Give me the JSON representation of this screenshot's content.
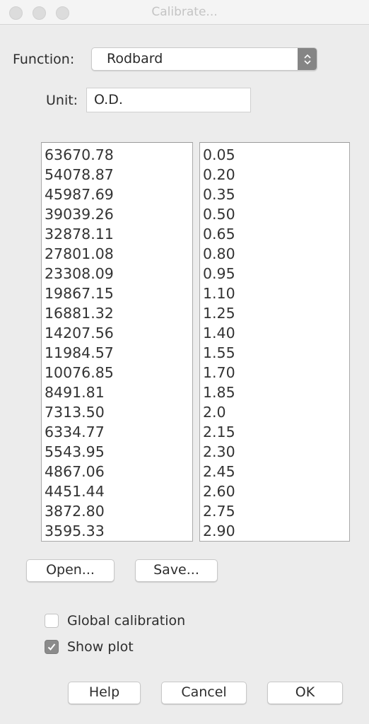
{
  "window": {
    "title": "Calibrate..."
  },
  "form": {
    "function_label": "Function:",
    "function_value": "Rodbard",
    "unit_label": "Unit:",
    "unit_value": "O.D."
  },
  "measured_values": [
    "63670.78",
    "54078.87",
    "45987.69",
    "39039.26",
    "32878.11",
    "27801.08",
    "23308.09",
    "19867.15",
    "16881.32",
    "14207.56",
    "11984.57",
    "10076.85",
    "8491.81",
    "7313.50",
    "6334.77",
    "5543.95",
    "4867.06",
    "4451.44",
    "3872.80",
    "3595.33"
  ],
  "calibrated_values": [
    "0.05",
    "0.20",
    "0.35",
    "0.50",
    "0.65",
    "0.80",
    "0.95",
    "1.10",
    "1.25",
    "1.40",
    "1.55",
    "1.70",
    "1.85",
    "2.0",
    "2.15",
    "2.30",
    "2.45",
    "2.60",
    "2.75",
    "2.90"
  ],
  "file_buttons": {
    "open": "Open...",
    "save": "Save..."
  },
  "options": {
    "global_calibration": {
      "label": "Global calibration",
      "checked": false
    },
    "show_plot": {
      "label": "Show plot",
      "checked": true
    }
  },
  "dialog_buttons": {
    "help": "Help",
    "cancel": "Cancel",
    "ok": "OK"
  },
  "icons": {
    "select_arrows": "up-down-chevron-icon",
    "checkmark": "checkmark-icon"
  }
}
